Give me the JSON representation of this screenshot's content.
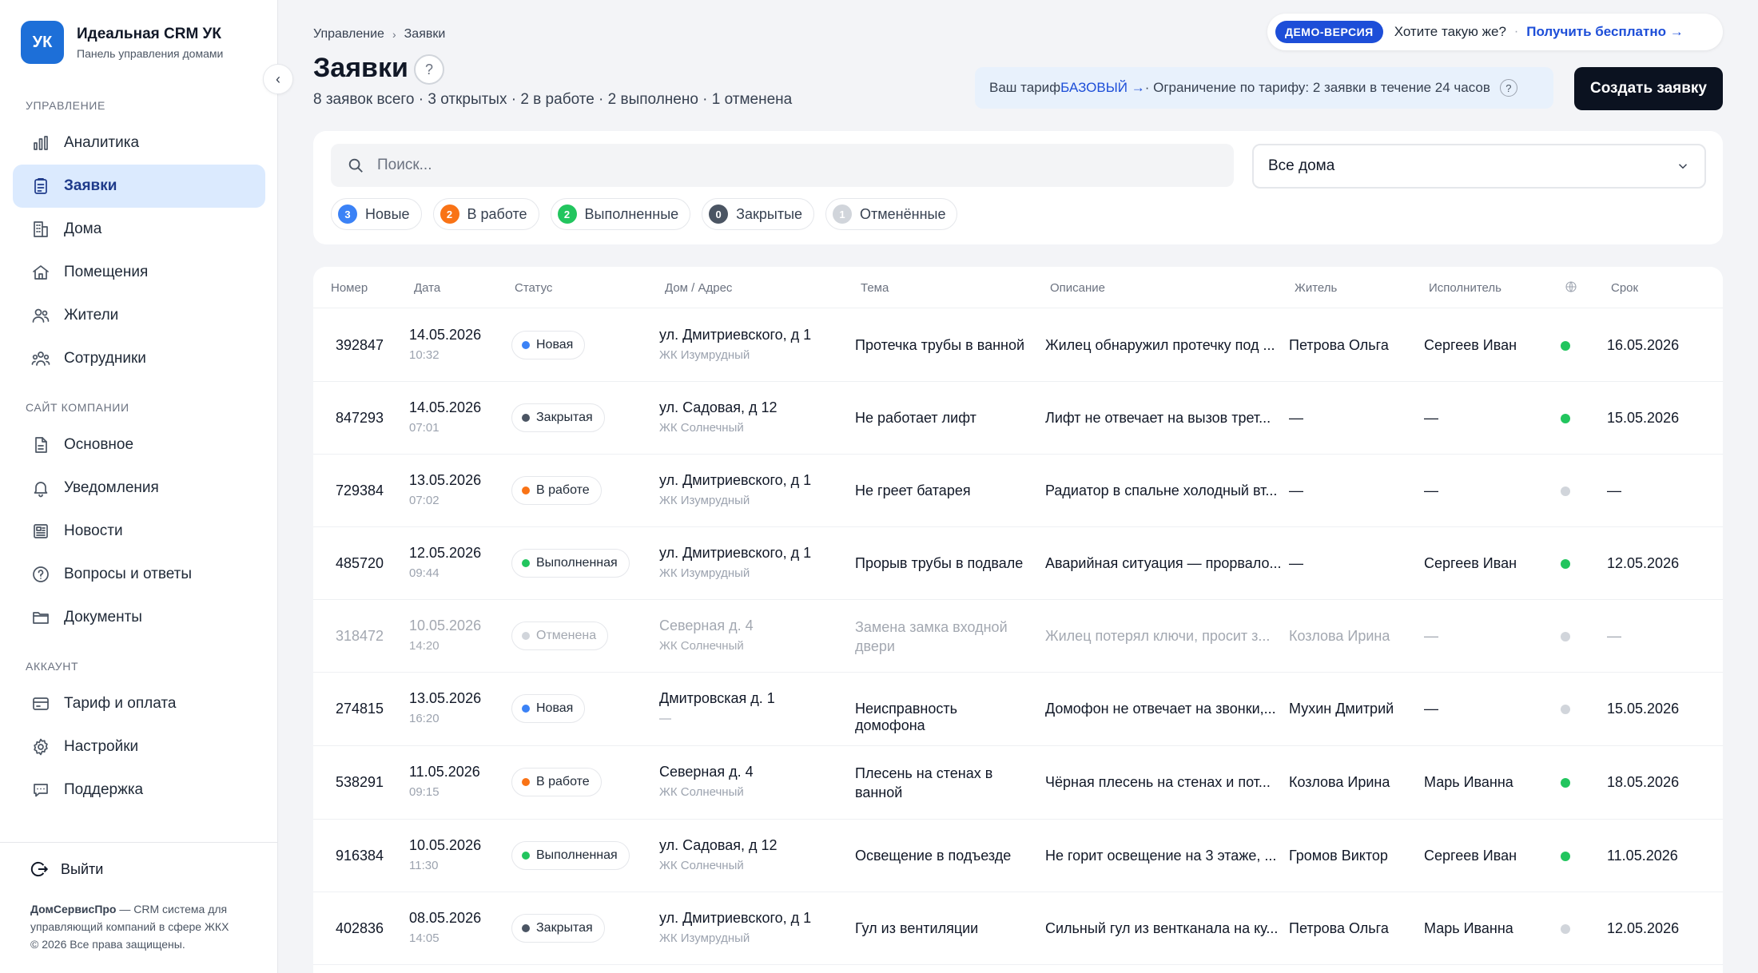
{
  "brand": {
    "logo": "УК",
    "name": "Идеальная CRM УК",
    "subtitle": "Панель управления домами"
  },
  "sidebar": {
    "sections": [
      {
        "title": "УПРАВЛЕНИЕ",
        "items": [
          {
            "label": "Аналитика",
            "icon": "chart-bar-icon"
          },
          {
            "label": "Заявки",
            "icon": "clipboard-list-icon",
            "active": true
          },
          {
            "label": "Дома",
            "icon": "building-icon"
          },
          {
            "label": "Помещения",
            "icon": "home-icon"
          },
          {
            "label": "Жители",
            "icon": "users-icon"
          },
          {
            "label": "Сотрудники",
            "icon": "team-icon"
          }
        ]
      },
      {
        "title": "САЙТ КОМПАНИИ",
        "items": [
          {
            "label": "Основное",
            "icon": "document-icon"
          },
          {
            "label": "Уведомления",
            "icon": "bell-icon"
          },
          {
            "label": "Новости",
            "icon": "newspaper-icon"
          },
          {
            "label": "Вопросы и ответы",
            "icon": "question-circle-icon"
          },
          {
            "label": "Документы",
            "icon": "folder-icon"
          }
        ]
      },
      {
        "title": "АККАУНТ",
        "items": [
          {
            "label": "Тариф и оплата",
            "icon": "credit-card-icon"
          },
          {
            "label": "Настройки",
            "icon": "gear-icon"
          },
          {
            "label": "Поддержка",
            "icon": "chat-icon"
          }
        ]
      }
    ],
    "logout": "Выйти",
    "footer": {
      "company": "ДомСервисПро",
      "text": " — CRM система для управляющий компаний в сфере ЖКХ",
      "copyright": "© 2026 Все права защищены."
    }
  },
  "header": {
    "breadcrumb": [
      "Управление",
      "Заявки"
    ],
    "title": "Заявки",
    "help": "?",
    "summary": "8 заявок всего · 3 открытых · 2 в работе · 2 выполнено · 1 отменена"
  },
  "demo": {
    "badge": "ДЕМО-ВЕРСИЯ",
    "question": "Хотите такую же?",
    "link": "Получить бесплатно →"
  },
  "tariff": {
    "prefix": "Ваш тариф ",
    "plan": "БАЗОВЫЙ →",
    "limit": " · Ограничение по тарифу: 2 заявки в течение 24 часов",
    "help": "?"
  },
  "create_button": "Создать заявку",
  "filters": {
    "search_placeholder": "Поиск...",
    "house_select": "Все дома",
    "chips": [
      {
        "count": "3",
        "label": "Новые",
        "color": "#3b82f6"
      },
      {
        "count": "2",
        "label": "В работе",
        "color": "#f97316"
      },
      {
        "count": "2",
        "label": "Выполненные",
        "color": "#22c55e"
      },
      {
        "count": "0",
        "label": "Закрытые",
        "color": "#4b5563"
      },
      {
        "count": "1",
        "label": "Отменённые",
        "color": "#d1d5db"
      }
    ]
  },
  "table": {
    "columns": [
      "Номер",
      "Дата",
      "Статус",
      "Дом / Адрес",
      "Тема",
      "Описание",
      "Житель",
      "Исполнитель",
      "",
      "Срок"
    ],
    "status_colors": {
      "Новая": "#3b82f6",
      "Закрытая": "#4b5563",
      "В работе": "#f97316",
      "Выполненная": "#22c55e",
      "Отменена": "#d1d5db"
    },
    "rows": [
      {
        "number": "392847",
        "date": "14.05.2026",
        "time": "10:32",
        "status": "Новая",
        "address": "ул. Дмитриевского, д 1",
        "complex": "ЖК Изумрудный",
        "topic": "Протечка трубы в ванной",
        "description": "Жилец обнаружил протечку под ...",
        "resident": "Петрова Ольга",
        "executor": "Сергеев Иван",
        "indicator": "#22c55e",
        "deadline": "16.05.2026"
      },
      {
        "number": "847293",
        "date": "14.05.2026",
        "time": "07:01",
        "status": "Закрытая",
        "address": "ул. Садовая, д 12",
        "complex": "ЖК Солнечный",
        "topic": "Не работает лифт",
        "description": "Лифт не отвечает на вызов трет...",
        "resident": "—",
        "executor": "—",
        "indicator": "#22c55e",
        "deadline": "15.05.2026"
      },
      {
        "number": "729384",
        "date": "13.05.2026",
        "time": "07:02",
        "status": "В работе",
        "address": "ул. Дмитриевского, д 1",
        "complex": "ЖК Изумрудный",
        "topic": "Не греет батарея",
        "description": "Радиатор в спальне холодный вт...",
        "resident": "—",
        "executor": "—",
        "indicator": "#d1d5db",
        "deadline": "—"
      },
      {
        "number": "485720",
        "date": "12.05.2026",
        "time": "09:44",
        "status": "Выполненная",
        "address": "ул. Дмитриевского, д 1",
        "complex": "ЖК Изумрудный",
        "topic": "Прорыв трубы в подвале",
        "description": "Аварийная ситуация — прорвало...",
        "resident": "—",
        "executor": "Сергеев Иван",
        "indicator": "#22c55e",
        "deadline": "12.05.2026"
      },
      {
        "number": "318472",
        "date": "10.05.2026",
        "time": "14:20",
        "status": "Отменена",
        "address": "Северная д. 4",
        "complex": "ЖК Солнечный",
        "topic": "Замена замка входной двери",
        "description": "Жилец потерял ключи, просит з...",
        "resident": "Козлова Ирина",
        "executor": "—",
        "indicator": "#d1d5db",
        "deadline": "—",
        "muted": true
      },
      {
        "number": "274815",
        "date": "13.05.2026",
        "time": "16:20",
        "status": "Новая",
        "address": "Дмитровская д. 1",
        "complex": "—",
        "topic": "Неисправность домофона",
        "description": "Домофон не отвечает на звонки,...",
        "resident": "Мухин Дмитрий",
        "executor": "—",
        "indicator": "#d1d5db",
        "deadline": "15.05.2026"
      },
      {
        "number": "538291",
        "date": "11.05.2026",
        "time": "09:15",
        "status": "В работе",
        "address": "Северная д. 4",
        "complex": "ЖК Солнечный",
        "topic": "Плесень на стенах в ванной",
        "description": "Чёрная плесень на стенах и пот...",
        "resident": "Козлова Ирина",
        "executor": "Марь Иванна",
        "indicator": "#22c55e",
        "deadline": "18.05.2026"
      },
      {
        "number": "916384",
        "date": "10.05.2026",
        "time": "11:30",
        "status": "Выполненная",
        "address": "ул. Садовая, д 12",
        "complex": "ЖК Солнечный",
        "topic": "Освещение в подъезде",
        "description": "Не горит освещение на 3 этаже, ...",
        "resident": "Громов Виктор",
        "executor": "Сергеев Иван",
        "indicator": "#22c55e",
        "deadline": "11.05.2026"
      },
      {
        "number": "402836",
        "date": "08.05.2026",
        "time": "14:05",
        "status": "Закрытая",
        "address": "ул. Дмитриевского, д 1",
        "complex": "ЖК Изумрудный",
        "topic": "Гул из вентиляции",
        "description": "Сильный гул из вентканала на ку...",
        "resident": "Петрова Ольга",
        "executor": "Марь Иванна",
        "indicator": "#d1d5db",
        "deadline": "12.05.2026"
      }
    ]
  }
}
